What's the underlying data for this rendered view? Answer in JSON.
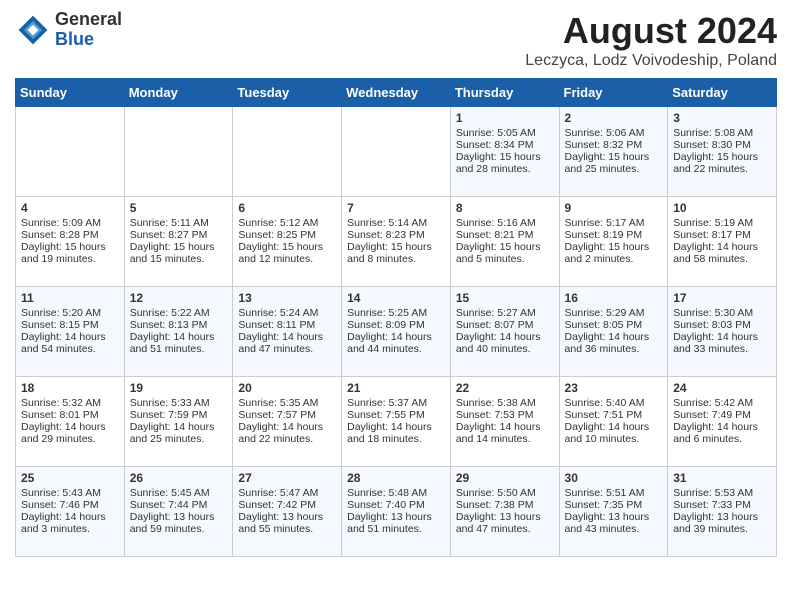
{
  "header": {
    "logo_general": "General",
    "logo_blue": "Blue",
    "month_title": "August 2024",
    "location": "Leczyca, Lodz Voivodeship, Poland"
  },
  "days_of_week": [
    "Sunday",
    "Monday",
    "Tuesday",
    "Wednesday",
    "Thursday",
    "Friday",
    "Saturday"
  ],
  "weeks": [
    [
      {
        "day": "",
        "info": ""
      },
      {
        "day": "",
        "info": ""
      },
      {
        "day": "",
        "info": ""
      },
      {
        "day": "",
        "info": ""
      },
      {
        "day": "1",
        "info": "Sunrise: 5:05 AM\nSunset: 8:34 PM\nDaylight: 15 hours\nand 28 minutes."
      },
      {
        "day": "2",
        "info": "Sunrise: 5:06 AM\nSunset: 8:32 PM\nDaylight: 15 hours\nand 25 minutes."
      },
      {
        "day": "3",
        "info": "Sunrise: 5:08 AM\nSunset: 8:30 PM\nDaylight: 15 hours\nand 22 minutes."
      }
    ],
    [
      {
        "day": "4",
        "info": "Sunrise: 5:09 AM\nSunset: 8:28 PM\nDaylight: 15 hours\nand 19 minutes."
      },
      {
        "day": "5",
        "info": "Sunrise: 5:11 AM\nSunset: 8:27 PM\nDaylight: 15 hours\nand 15 minutes."
      },
      {
        "day": "6",
        "info": "Sunrise: 5:12 AM\nSunset: 8:25 PM\nDaylight: 15 hours\nand 12 minutes."
      },
      {
        "day": "7",
        "info": "Sunrise: 5:14 AM\nSunset: 8:23 PM\nDaylight: 15 hours\nand 8 minutes."
      },
      {
        "day": "8",
        "info": "Sunrise: 5:16 AM\nSunset: 8:21 PM\nDaylight: 15 hours\nand 5 minutes."
      },
      {
        "day": "9",
        "info": "Sunrise: 5:17 AM\nSunset: 8:19 PM\nDaylight: 15 hours\nand 2 minutes."
      },
      {
        "day": "10",
        "info": "Sunrise: 5:19 AM\nSunset: 8:17 PM\nDaylight: 14 hours\nand 58 minutes."
      }
    ],
    [
      {
        "day": "11",
        "info": "Sunrise: 5:20 AM\nSunset: 8:15 PM\nDaylight: 14 hours\nand 54 minutes."
      },
      {
        "day": "12",
        "info": "Sunrise: 5:22 AM\nSunset: 8:13 PM\nDaylight: 14 hours\nand 51 minutes."
      },
      {
        "day": "13",
        "info": "Sunrise: 5:24 AM\nSunset: 8:11 PM\nDaylight: 14 hours\nand 47 minutes."
      },
      {
        "day": "14",
        "info": "Sunrise: 5:25 AM\nSunset: 8:09 PM\nDaylight: 14 hours\nand 44 minutes."
      },
      {
        "day": "15",
        "info": "Sunrise: 5:27 AM\nSunset: 8:07 PM\nDaylight: 14 hours\nand 40 minutes."
      },
      {
        "day": "16",
        "info": "Sunrise: 5:29 AM\nSunset: 8:05 PM\nDaylight: 14 hours\nand 36 minutes."
      },
      {
        "day": "17",
        "info": "Sunrise: 5:30 AM\nSunset: 8:03 PM\nDaylight: 14 hours\nand 33 minutes."
      }
    ],
    [
      {
        "day": "18",
        "info": "Sunrise: 5:32 AM\nSunset: 8:01 PM\nDaylight: 14 hours\nand 29 minutes."
      },
      {
        "day": "19",
        "info": "Sunrise: 5:33 AM\nSunset: 7:59 PM\nDaylight: 14 hours\nand 25 minutes."
      },
      {
        "day": "20",
        "info": "Sunrise: 5:35 AM\nSunset: 7:57 PM\nDaylight: 14 hours\nand 22 minutes."
      },
      {
        "day": "21",
        "info": "Sunrise: 5:37 AM\nSunset: 7:55 PM\nDaylight: 14 hours\nand 18 minutes."
      },
      {
        "day": "22",
        "info": "Sunrise: 5:38 AM\nSunset: 7:53 PM\nDaylight: 14 hours\nand 14 minutes."
      },
      {
        "day": "23",
        "info": "Sunrise: 5:40 AM\nSunset: 7:51 PM\nDaylight: 14 hours\nand 10 minutes."
      },
      {
        "day": "24",
        "info": "Sunrise: 5:42 AM\nSunset: 7:49 PM\nDaylight: 14 hours\nand 6 minutes."
      }
    ],
    [
      {
        "day": "25",
        "info": "Sunrise: 5:43 AM\nSunset: 7:46 PM\nDaylight: 14 hours\nand 3 minutes."
      },
      {
        "day": "26",
        "info": "Sunrise: 5:45 AM\nSunset: 7:44 PM\nDaylight: 13 hours\nand 59 minutes."
      },
      {
        "day": "27",
        "info": "Sunrise: 5:47 AM\nSunset: 7:42 PM\nDaylight: 13 hours\nand 55 minutes."
      },
      {
        "day": "28",
        "info": "Sunrise: 5:48 AM\nSunset: 7:40 PM\nDaylight: 13 hours\nand 51 minutes."
      },
      {
        "day": "29",
        "info": "Sunrise: 5:50 AM\nSunset: 7:38 PM\nDaylight: 13 hours\nand 47 minutes."
      },
      {
        "day": "30",
        "info": "Sunrise: 5:51 AM\nSunset: 7:35 PM\nDaylight: 13 hours\nand 43 minutes."
      },
      {
        "day": "31",
        "info": "Sunrise: 5:53 AM\nSunset: 7:33 PM\nDaylight: 13 hours\nand 39 minutes."
      }
    ]
  ]
}
